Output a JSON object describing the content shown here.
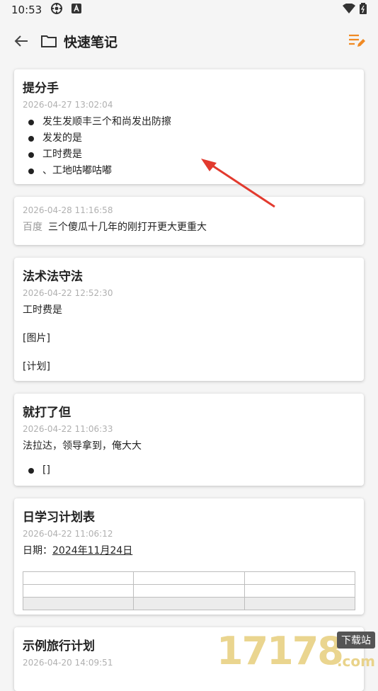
{
  "status_bar": {
    "time": "10:53"
  },
  "app_bar": {
    "title": "快速笔记"
  },
  "notes": [
    {
      "title": "提分手",
      "date": "2026-04-27 13:02:04",
      "bullets": [
        "发生发顺丰三个和尚发出防擦",
        "发发的是",
        "工时费是",
        "、工地咕嘟咕嘟"
      ]
    },
    {
      "date": "2026-04-28 11:16:58",
      "prefix": "百度",
      "text": "三个傻瓜十几年的刚打开更大更重大"
    },
    {
      "title": "法术法守法",
      "date": "2026-04-22 12:52:30",
      "lines": [
        "工时费是",
        "[图片]",
        "[计划]"
      ]
    },
    {
      "title": "就打了但",
      "date": "2026-04-22 11:06:33",
      "text": "法拉达，领导拿到，俺大大",
      "bullets": [
        "[]"
      ]
    },
    {
      "title": "日学习计划表",
      "date": "2026-04-22 11:06:12",
      "label": "日期：",
      "value": "2024年11月24日"
    },
    {
      "title": "示例旅行计划",
      "date": "2026-04-20 14:09:51"
    }
  ],
  "watermark": {
    "number": "17178",
    "tag": "下载站",
    "domain": ".com"
  },
  "colors": {
    "accent": "#f08a24",
    "arrow": "#e23a2e"
  }
}
